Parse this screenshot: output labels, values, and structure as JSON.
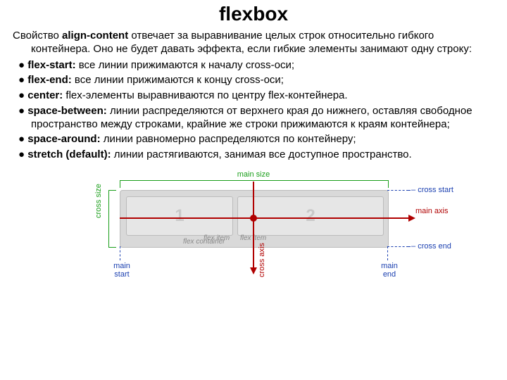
{
  "title": "flexbox",
  "intro_prefix": "Свойство ",
  "intro_bold": "align-content",
  "intro_suffix": " отвечает за выравнивание целых строк относительно гибкого контейнера. Оно не будет давать эффекта, если гибкие элементы занимают одну строку:",
  "bullets": [
    {
      "term": "flex-start:",
      "desc": " все линии прижимаются к началу cross-оси;"
    },
    {
      "term": "flex-end:",
      "desc": " все линии прижимаются к концу cross-оси;"
    },
    {
      "term": "center:",
      "desc": " flex-элементы выравниваются по центру flex-контейнера."
    },
    {
      "term": "space-between:",
      "desc": " линии распределяются от верхнего края до нижнего, оставляя свободное пространство между строками, крайние же строки прижимаются к краям контейнера;"
    },
    {
      "term": "space-around:",
      "desc": " линии равномерно распределяются по контейнеру;"
    },
    {
      "term": "stretch (default):",
      "desc": " линии растягиваются, занимая все доступное пространство."
    }
  ],
  "diagram": {
    "main_size": "main size",
    "cross_size": "cross size",
    "main_axis": "main axis",
    "cross_axis": "cross axis",
    "cross_start": "cross start",
    "cross_end": "cross end",
    "main_start": "main\nstart",
    "main_end": "main\nend",
    "item1": "1",
    "item2": "2",
    "flex_item_label_1": "flex item",
    "flex_item_label_2": "flex item",
    "flex_container_label": "flex container"
  }
}
